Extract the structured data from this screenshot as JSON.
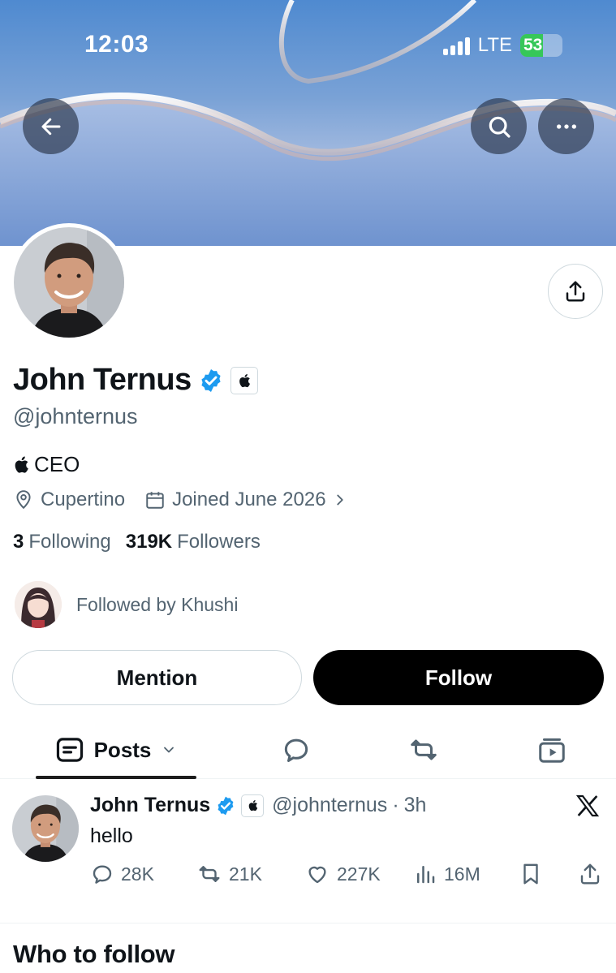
{
  "status_bar": {
    "time": "12:03",
    "network": "LTE",
    "battery": "53",
    "battery_level_pct": 53
  },
  "profile": {
    "name": "John Ternus",
    "handle": "@johnternus",
    "bio": "CEO",
    "location": "Cupertino",
    "joined": "Joined June 2026",
    "following_count": "3",
    "following_label": "Following",
    "followers_count": "319K",
    "followers_label": "Followers",
    "followed_by": "Followed by Khushi"
  },
  "buttons": {
    "mention": "Mention",
    "follow": "Follow"
  },
  "tabs": {
    "posts": "Posts"
  },
  "post": {
    "author": "John Ternus",
    "handle": "@johnternus",
    "separator": "·",
    "time": "3h",
    "text": "hello",
    "replies": "28K",
    "reposts": "21K",
    "likes": "227K",
    "views": "16M"
  },
  "section": {
    "who_to_follow": "Who to follow"
  },
  "colors": {
    "verified": "#1d9bf0",
    "follow_bg": "#000000",
    "muted_text": "#536471",
    "battery_fill": "#36c759"
  },
  "icons": [
    "back-arrow-icon",
    "search-icon",
    "more-icon",
    "share-icon",
    "verified-badge-icon",
    "apple-logo-icon",
    "location-icon",
    "calendar-icon",
    "chevron-right-icon",
    "posts-icon",
    "chevron-down-icon",
    "reply-icon",
    "repost-icon",
    "media-icon",
    "x-logo-icon",
    "like-icon",
    "views-icon",
    "bookmark-icon"
  ]
}
